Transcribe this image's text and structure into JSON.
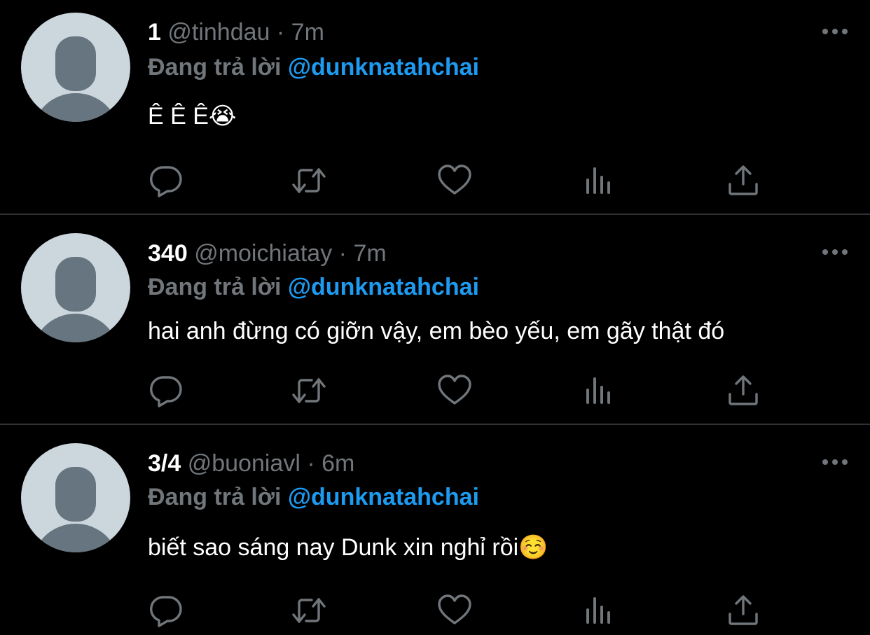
{
  "feed": {
    "tweets": [
      {
        "name": "1",
        "handle": "@tinhdau",
        "separator": "·",
        "time": "7m",
        "replying_label": "Đang trả lời",
        "replying_to": "@dunknatahchai",
        "text": "Ê Ê Ê😭"
      },
      {
        "name": "340",
        "handle": "@moichiatay",
        "separator": "·",
        "time": "7m",
        "replying_label": "Đang trả lời",
        "replying_to": "@dunknatahchai",
        "text": "hai anh đừng có giỡn vậy, em bèo yếu, em gãy thật đó"
      },
      {
        "name": "3/4",
        "handle": "@buoniavl",
        "separator": "·",
        "time": "6m",
        "replying_label": "Đang trả lời",
        "replying_to": "@dunknatahchai",
        "text": "biết sao sáng nay Dunk xin nghỉ rồi☺️"
      }
    ]
  },
  "icons": {
    "avatar": "default-avatar-icon",
    "more": "more-horizontal-icon",
    "reply": "reply-icon",
    "retweet": "retweet-icon",
    "like": "like-icon",
    "analytics": "analytics-icon",
    "share": "share-icon"
  },
  "colors": {
    "background": "#000000",
    "name": "#ffffff",
    "muted": "#71767b",
    "mention": "#1d9bf0",
    "divider": "#2f3336",
    "avatar_bg": "#ccd6dd",
    "avatar_fg": "#66757f"
  }
}
